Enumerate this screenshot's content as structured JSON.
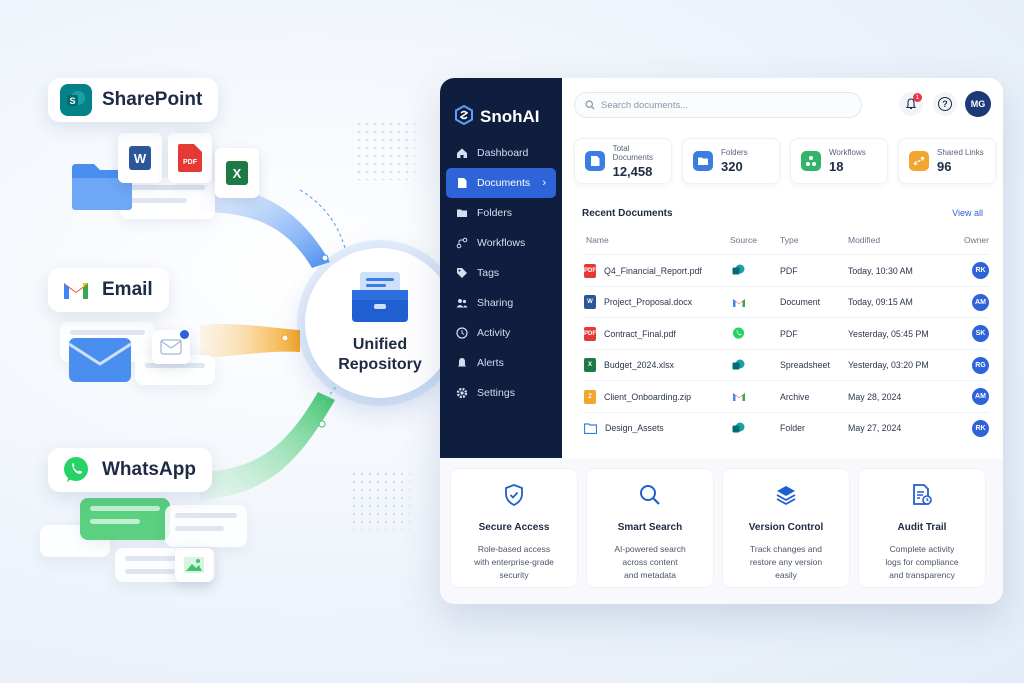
{
  "sources": {
    "sharepoint": "SharePoint",
    "email": "Email",
    "whatsapp": "WhatsApp"
  },
  "file_badges": {
    "pdf": "PDF"
  },
  "hub": {
    "title_line1": "Unified",
    "title_line2": "Repository"
  },
  "app": {
    "brand": "SnohAI",
    "nav": [
      {
        "label": "Dashboard",
        "icon": "home-icon"
      },
      {
        "label": "Documents",
        "icon": "document-icon",
        "active": true,
        "chevron": "›"
      },
      {
        "label": "Folders",
        "icon": "folder-icon"
      },
      {
        "label": "Workflows",
        "icon": "workflow-icon"
      },
      {
        "label": "Tags",
        "icon": "tag-icon"
      },
      {
        "label": "Sharing",
        "icon": "users-icon"
      },
      {
        "label": "Activity",
        "icon": "activity-icon"
      },
      {
        "label": "Alerts",
        "icon": "bell-icon"
      },
      {
        "label": "Settings",
        "icon": "gear-icon"
      }
    ],
    "search_placeholder": "Search documents...",
    "notification_count": "1",
    "help": "?",
    "user_initials": "MG",
    "stats": [
      {
        "label": "Total Documents",
        "value": "12,458",
        "color": "#3b7de0"
      },
      {
        "label": "Folders",
        "value": "320",
        "color": "#3b7de0"
      },
      {
        "label": "Workflows",
        "value": "18",
        "color": "#34b36b"
      },
      {
        "label": "Shared Links",
        "value": "96",
        "color": "#f2a531"
      }
    ],
    "recent_title": "Recent Documents",
    "view_all": "View all",
    "columns": {
      "name": "Name",
      "source": "Source",
      "type": "Type",
      "modified": "Modified",
      "owner": "Owner"
    },
    "rows": [
      {
        "name": "Q4_Financial_Report.pdf",
        "file": "pdf",
        "source": "sharepoint",
        "type": "PDF",
        "modified": "Today, 10:30 AM",
        "owner": "RK"
      },
      {
        "name": "Project_Proposal.docx",
        "file": "word",
        "source": "gmail",
        "type": "Document",
        "modified": "Today, 09:15 AM",
        "owner": "AM"
      },
      {
        "name": "Contract_Final.pdf",
        "file": "pdf",
        "source": "whatsapp",
        "type": "PDF",
        "modified": "Yesterday, 05:45 PM",
        "owner": "SK"
      },
      {
        "name": "Budget_2024.xlsx",
        "file": "excel",
        "source": "sharepoint",
        "type": "Spreadsheet",
        "modified": "Yesterday, 03:20 PM",
        "owner": "RG"
      },
      {
        "name": "Client_Onboarding.zip",
        "file": "zip",
        "source": "gmail",
        "type": "Archive",
        "modified": "May 28, 2024",
        "owner": "AM"
      },
      {
        "name": "Design_Assets",
        "file": "folder",
        "source": "sharepoint",
        "type": "Folder",
        "modified": "May 27, 2024",
        "owner": "RK"
      }
    ],
    "features": [
      {
        "title": "Secure Access",
        "desc1": "Role-based access",
        "desc2": "with enterprise-grade",
        "desc3": "security",
        "icon": "shield-icon"
      },
      {
        "title": "Smart Search",
        "desc1": "AI-powered search",
        "desc2": "across content",
        "desc3": "and metadata",
        "icon": "search-icon"
      },
      {
        "title": "Version Control",
        "desc1": "Track changes and",
        "desc2": "restore any version",
        "desc3": "easily",
        "icon": "layers-icon"
      },
      {
        "title": "Audit Trail",
        "desc1": "Complete activity",
        "desc2": "logs for compliance",
        "desc3": "and transparency",
        "icon": "audit-icon"
      }
    ]
  },
  "colors": {
    "primary": "#2f63d8",
    "sidebar": "#0f1d3f",
    "sharepoint": "#038387",
    "gmail_red": "#ea4335",
    "whatsapp": "#25d366",
    "excel": "#1d7a45",
    "word": "#2b579a",
    "pdf": "#e53935"
  }
}
